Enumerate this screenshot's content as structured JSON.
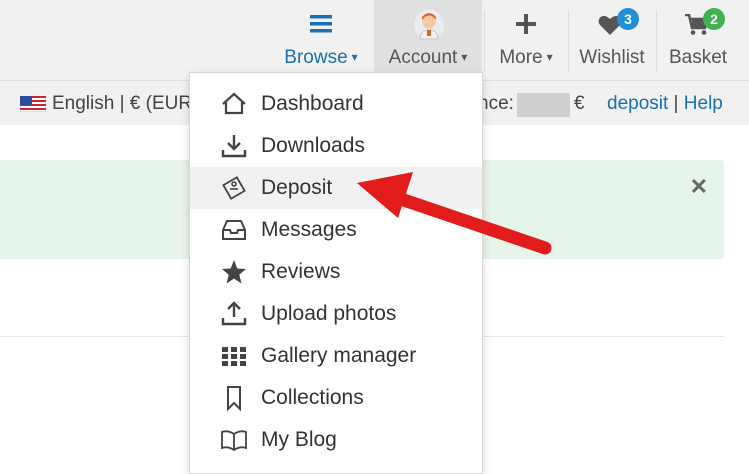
{
  "nav": {
    "browse": {
      "label": "Browse",
      "icon": "menu-icon"
    },
    "account": {
      "label": "Account",
      "icon": "avatar"
    },
    "more": {
      "label": "More",
      "icon": "plus-icon"
    },
    "wishlist": {
      "label": "Wishlist",
      "icon": "heart-icon",
      "badge": "3"
    },
    "basket": {
      "label": "Basket",
      "icon": "cart-icon",
      "badge": "2"
    },
    "chevron": "⌄"
  },
  "subbar": {
    "language": "English | € (EUR",
    "balance_suffix": "nce:",
    "currency": "€",
    "deposit": "deposit",
    "divider": " | ",
    "help": "Help"
  },
  "alert": {
    "close": "✕"
  },
  "menu": {
    "items": [
      {
        "label": "Dashboard",
        "icon": "home-icon"
      },
      {
        "label": "Downloads",
        "icon": "download-icon"
      },
      {
        "label": "Deposit",
        "icon": "tag-icon"
      },
      {
        "label": "Messages",
        "icon": "inbox-icon"
      },
      {
        "label": "Reviews",
        "icon": "star-icon"
      },
      {
        "label": "Upload photos",
        "icon": "upload-icon"
      },
      {
        "label": "Gallery manager",
        "icon": "grid-icon"
      },
      {
        "label": "Collections",
        "icon": "bookmark-icon"
      },
      {
        "label": "My Blog",
        "icon": "book-icon"
      }
    ]
  },
  "colors": {
    "accent": "#1a6fae",
    "wishlist_badge": "#1f8fd6",
    "basket_badge": "#3fb34f",
    "arrow": "#e21b1b",
    "alert_bg": "#e6f4ea"
  }
}
